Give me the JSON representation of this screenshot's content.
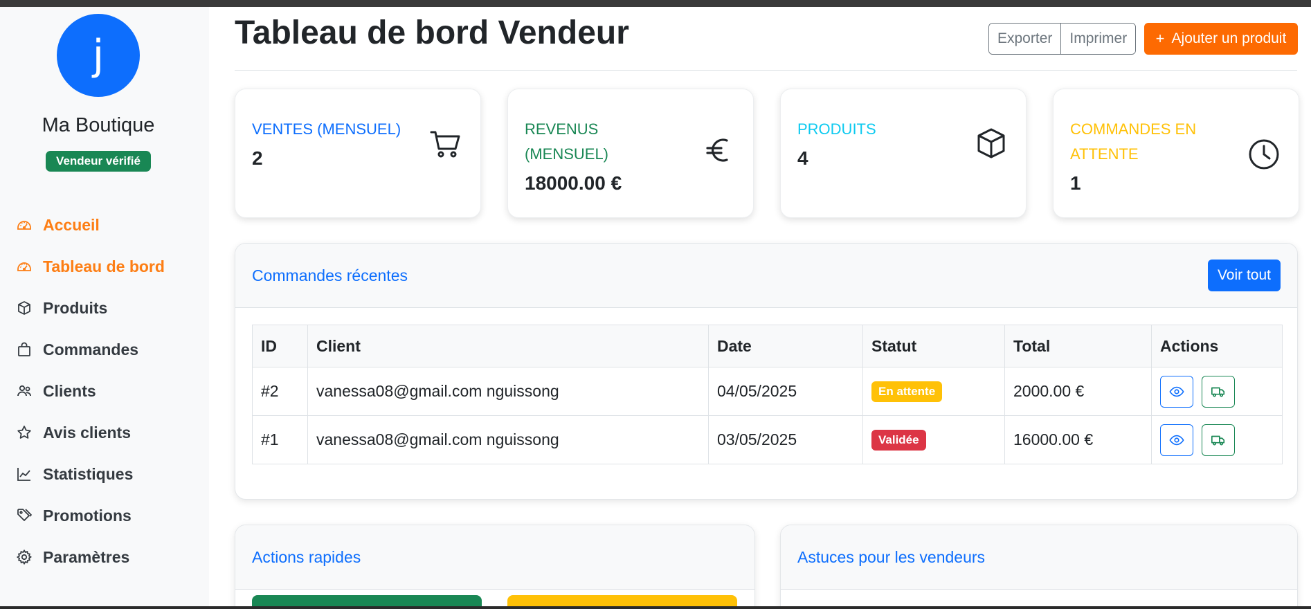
{
  "sidebar": {
    "avatar_letter": "j",
    "shop_name": "Ma Boutique",
    "badge": "Vendeur vérifié",
    "items": [
      {
        "label": "Accueil",
        "icon": "speedometer-icon",
        "active": true
      },
      {
        "label": "Tableau de bord",
        "icon": "speedometer-icon",
        "active": true
      },
      {
        "label": "Produits",
        "icon": "box-icon",
        "active": false
      },
      {
        "label": "Commandes",
        "icon": "bag-icon",
        "active": false
      },
      {
        "label": "Clients",
        "icon": "people-icon",
        "active": false
      },
      {
        "label": "Avis clients",
        "icon": "star-icon",
        "active": false
      },
      {
        "label": "Statistiques",
        "icon": "graph-icon",
        "active": false
      },
      {
        "label": "Promotions",
        "icon": "tags-icon",
        "active": false
      },
      {
        "label": "Paramètres",
        "icon": "gear-icon",
        "active": false
      }
    ]
  },
  "header": {
    "title": "Tableau de bord Vendeur",
    "export_label": "Exporter",
    "print_label": "Imprimer",
    "add_plus": "+",
    "add_label": "Ajouter un produit"
  },
  "stats": [
    {
      "label": "VENTES (MENSUEL)",
      "value": "2",
      "color": "#0d6efd",
      "icon": "cart-icon"
    },
    {
      "label": "REVENUS (MENSUEL)",
      "value": "18000.00 €",
      "color": "#198754",
      "icon": "euro-icon"
    },
    {
      "label": "PRODUITS",
      "value": "4",
      "color": "#0dcaf0",
      "icon": "box-icon"
    },
    {
      "label": "COMMANDES EN ATTENTE",
      "value": "1",
      "color": "#ffc107",
      "icon": "clock-icon"
    }
  ],
  "orders": {
    "title": "Commandes récentes",
    "view_all": "Voir tout",
    "columns": [
      "ID",
      "Client",
      "Date",
      "Statut",
      "Total",
      "Actions"
    ],
    "rows": [
      {
        "id": "#2",
        "client": "vanessa08@gmail.com nguissong",
        "date": "04/05/2025",
        "status": "En attente",
        "total": "2000.00 €"
      },
      {
        "id": "#1",
        "client": "vanessa08@gmail.com nguissong",
        "date": "03/05/2025",
        "status": "Validée",
        "total": "16000.00 €"
      }
    ]
  },
  "quick_actions": {
    "title": "Actions rapides"
  },
  "tips": {
    "title": "Astuces pour les vendeurs"
  },
  "colors": {
    "accent": "#fd7e14",
    "primary": "#0d6efd",
    "success": "#198754",
    "warning": "#ffc107",
    "danger": "#dc3545",
    "orange_button": "#fd6a02"
  }
}
